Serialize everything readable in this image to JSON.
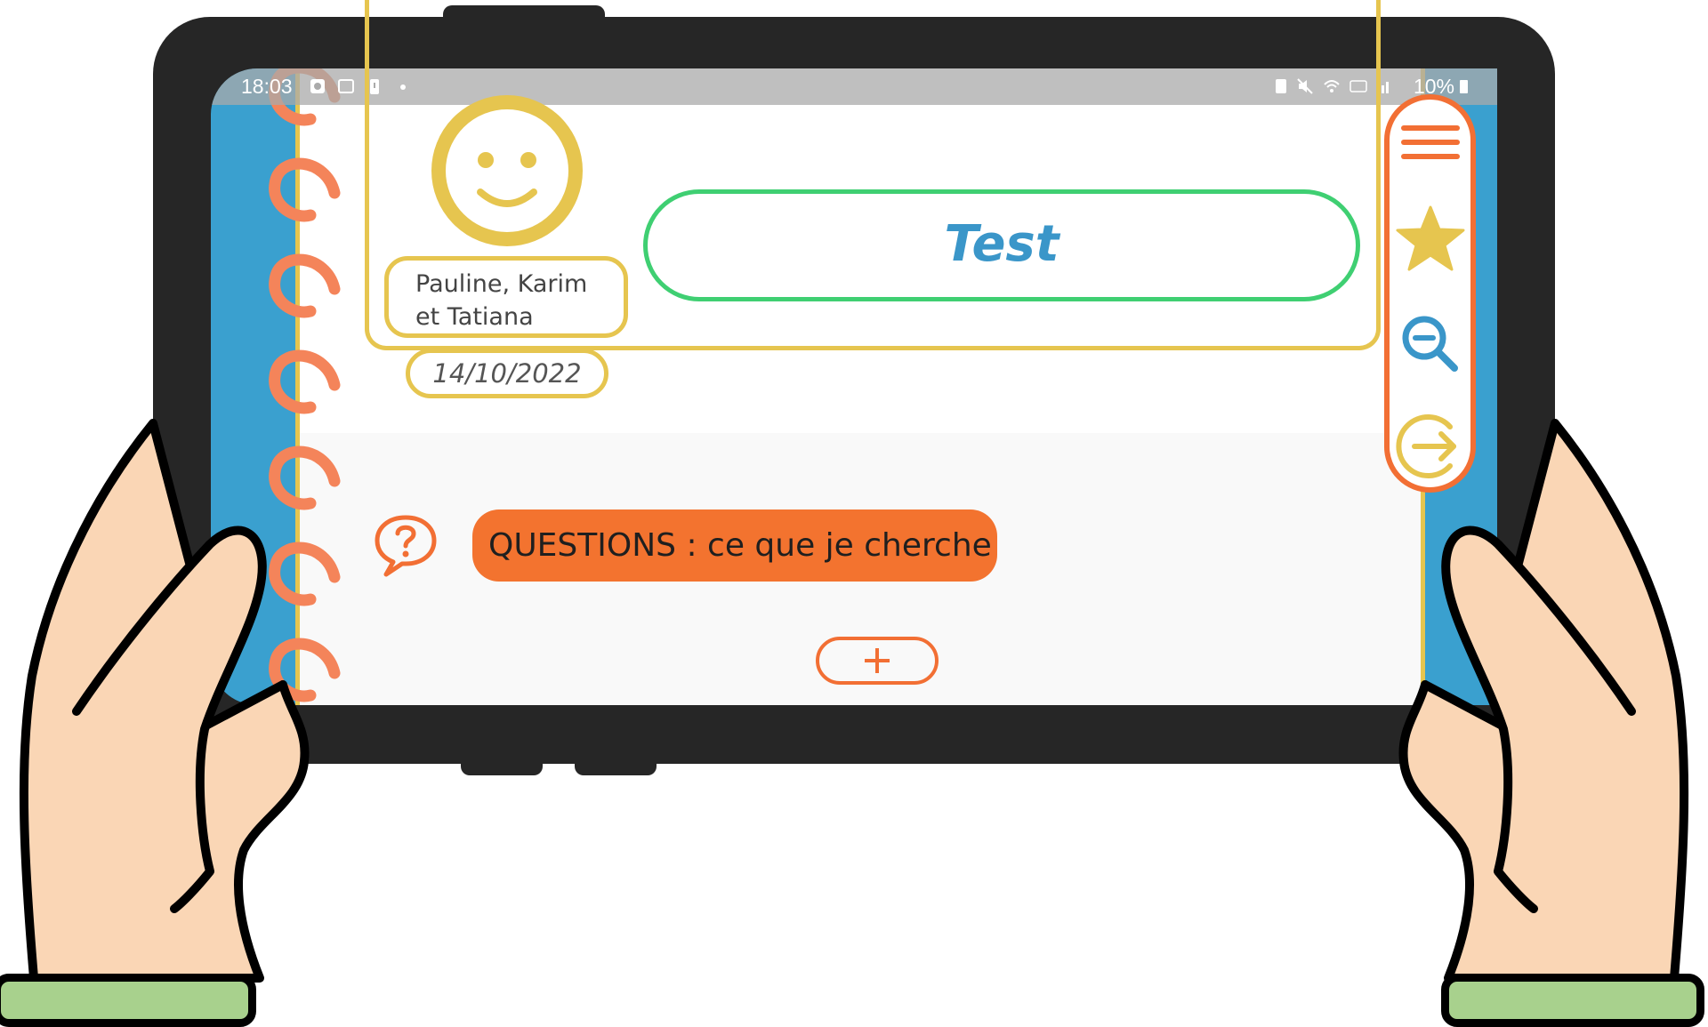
{
  "status_bar": {
    "time": "18:03",
    "battery": "10%",
    "icons_left": [
      "notification-icon",
      "gallery-icon",
      "battery-alert-icon",
      "dot-icon"
    ],
    "icons_right": [
      "sim-icon",
      "mute-icon",
      "wifi-icon",
      "volte-icon",
      "signal-icon",
      "battery-icon"
    ]
  },
  "profile": {
    "avatar_icon": "smiley-face-icon",
    "names_line1": "Pauline, Karim",
    "names_line2": "et Tatiana",
    "date": "14/10/2022",
    "title": "Test"
  },
  "toolbar": {
    "items": [
      {
        "icon": "menu-icon"
      },
      {
        "icon": "star-icon"
      },
      {
        "icon": "zoom-out-icon"
      },
      {
        "icon": "exit-icon"
      }
    ]
  },
  "questions": {
    "icon": "question-speech-bubble-icon",
    "label": "QUESTIONS : ce que je cherche",
    "add_icon": "plus-icon"
  },
  "colors": {
    "screen_blue": "#3aa0cf",
    "yellow": "#e6c54f",
    "orange": "#f26f34",
    "green": "#3fcf72",
    "title_blue": "#3a96c9",
    "skin": "#fad6b5",
    "sleeve_green": "#a8d18d",
    "frame": "#262626"
  }
}
